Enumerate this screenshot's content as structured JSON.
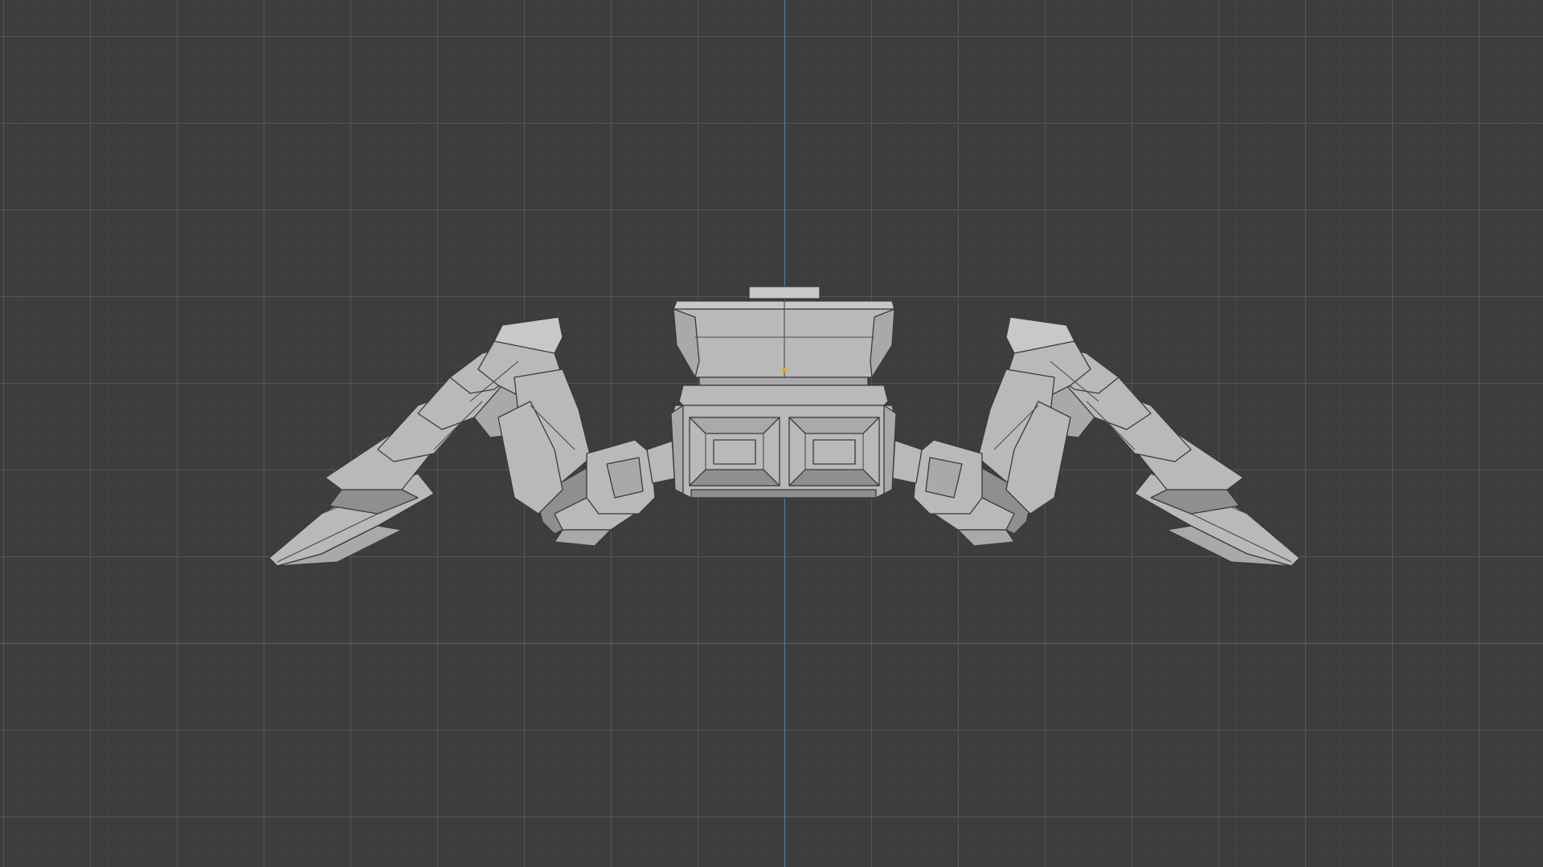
{
  "viewport": {
    "background_color": "#3d3d3d",
    "grid_major_color": "#585858",
    "grid_minor_color": "#464646",
    "axis_x_color": "#a8434b",
    "axis_y_color": "#4d7fb3"
  },
  "model": {
    "shade_light": "#b9b9b9",
    "shade_mid": "#a9a9a9",
    "shade_dark": "#8f8f8f",
    "shade_top": "#c8c8c8",
    "origin_color": "#e8a030"
  }
}
